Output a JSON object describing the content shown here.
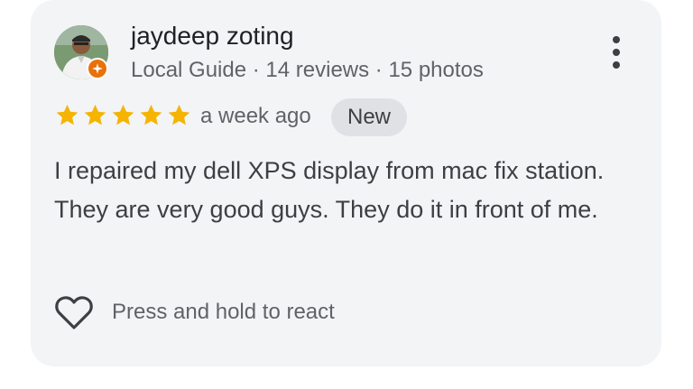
{
  "reviewer": {
    "name": "jaydeep zoting",
    "meta": "Local Guide · 14 reviews · 15 photos",
    "badge_icon": "local-guide-star-icon"
  },
  "review": {
    "rating": 5,
    "rating_max": 5,
    "time": "a week ago",
    "new_label": "New",
    "text": "I repaired my dell XPS display from mac fix station. They are very good guys. They do it in front of me."
  },
  "reaction": {
    "label": "Press and hold to react",
    "icon": "heart-icon"
  },
  "colors": {
    "card_bg": "#f3f4f6",
    "star": "#f4b400",
    "badge": "#e8710a",
    "chip_bg": "#dfe1e5"
  }
}
